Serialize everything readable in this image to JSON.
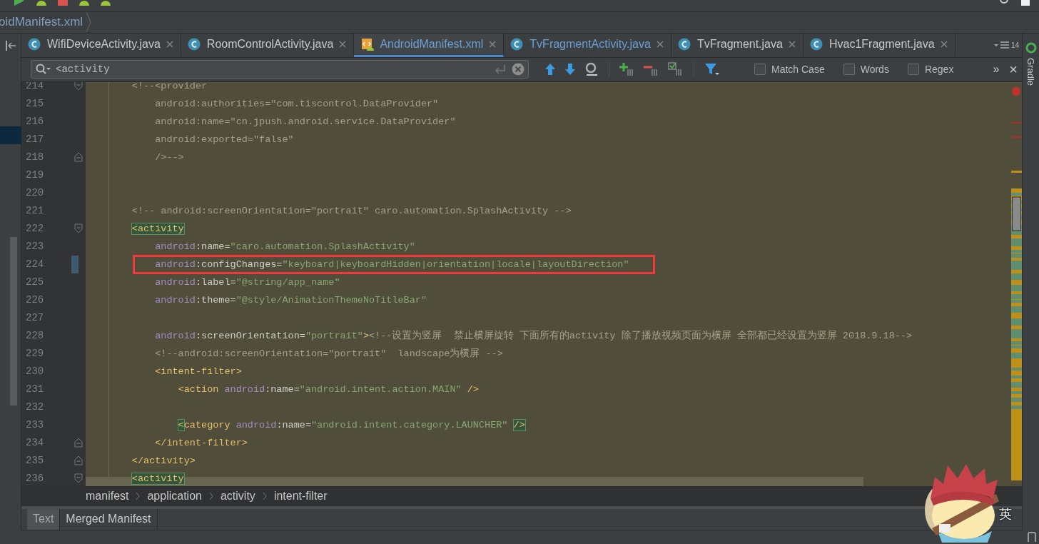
{
  "file_crumb": {
    "label": "oidManifest.xml"
  },
  "tabs": [
    {
      "label": "WifiDeviceActivity.java",
      "kind": "class",
      "selected": false,
      "modified": false
    },
    {
      "label": "RoomControlActivity.java",
      "kind": "class",
      "selected": false,
      "modified": false
    },
    {
      "label": "AndroidManifest.xml",
      "kind": "xml",
      "selected": true,
      "modified": true
    },
    {
      "label": "TvFragmentActivity.java",
      "kind": "class",
      "selected": false,
      "modified": true
    },
    {
      "label": "TvFragment.java",
      "kind": "class",
      "selected": false,
      "modified": false
    },
    {
      "label": "Hvac1Fragment.java",
      "kind": "class",
      "selected": false,
      "modified": false
    }
  ],
  "tab_overflow": {
    "count": "14"
  },
  "search": {
    "value": "<activity",
    "more": "»",
    "close": "×",
    "options": [
      {
        "label": "Match Case",
        "checked": false
      },
      {
        "label": "Words",
        "checked": false
      },
      {
        "label": "Regex",
        "checked": false
      }
    ]
  },
  "side_tool": {
    "label": "Gradle"
  },
  "editor": {
    "lines": [
      {
        "number": "214",
        "kind": "fold-start",
        "framed": false,
        "changed": false,
        "tokens": [
          {
            "kind": "comment",
            "text": "        <!--<provider"
          }
        ]
      },
      {
        "number": "215",
        "kind": "plain",
        "framed": false,
        "changed": false,
        "tokens": [
          {
            "kind": "comment",
            "text": "            android:authorities=\"com.tiscontrol.DataProvider\""
          }
        ]
      },
      {
        "number": "216",
        "kind": "plain",
        "framed": false,
        "changed": false,
        "tokens": [
          {
            "kind": "comment",
            "text": "            android:name=\"cn.jpush.android.service.DataProvider\""
          }
        ]
      },
      {
        "number": "217",
        "kind": "plain",
        "framed": false,
        "changed": false,
        "tokens": [
          {
            "kind": "comment",
            "text": "            android:exported=\"false\""
          }
        ]
      },
      {
        "number": "218",
        "kind": "fold-end",
        "framed": false,
        "changed": false,
        "tokens": [
          {
            "kind": "comment",
            "text": "            />-->"
          }
        ]
      },
      {
        "number": "219",
        "kind": "plain",
        "framed": false,
        "changed": false
      },
      {
        "number": "220",
        "kind": "plain",
        "framed": false,
        "changed": false
      },
      {
        "number": "221",
        "kind": "plain",
        "framed": false,
        "changed": false,
        "tokens": [
          {
            "kind": "comment",
            "text": "        <!-- android:screenOrientation=\"portrait\" caro.automation.SplashActivity -->"
          }
        ]
      },
      {
        "number": "222",
        "kind": "fold-start",
        "framed": false,
        "changed": false,
        "tokens": [
          {
            "kind": "match",
            "text": "        <activity"
          }
        ]
      },
      {
        "number": "223",
        "kind": "plain",
        "framed": false,
        "changed": false,
        "tokens": [
          {
            "kind": "ns",
            "text": "            android"
          },
          {
            "kind": "attr",
            "text": ":name="
          },
          {
            "kind": "value",
            "text": "\"caro.automation.SplashActivity\""
          }
        ]
      },
      {
        "number": "224",
        "kind": "plain",
        "framed": true,
        "changed": true,
        "tokens": [
          {
            "kind": "ns",
            "text": "            android"
          },
          {
            "kind": "attr",
            "text": ":configChanges="
          },
          {
            "kind": "value",
            "text": "\"keyboard|keyboardHidden|orientation|locale|layoutDirection\""
          }
        ]
      },
      {
        "number": "225",
        "kind": "plain",
        "framed": false,
        "changed": false,
        "tokens": [
          {
            "kind": "ns",
            "text": "            android"
          },
          {
            "kind": "attr",
            "text": ":label="
          },
          {
            "kind": "value",
            "text": "\"@string/app_name\""
          }
        ]
      },
      {
        "number": "226",
        "kind": "plain",
        "framed": false,
        "changed": false,
        "tokens": [
          {
            "kind": "ns",
            "text": "            android"
          },
          {
            "kind": "attr",
            "text": ":theme="
          },
          {
            "kind": "value",
            "text": "\"@style/AnimationThemeNoTitleBar\""
          }
        ]
      },
      {
        "number": "227",
        "kind": "plain",
        "framed": false,
        "changed": false
      },
      {
        "number": "228",
        "kind": "plain",
        "framed": false,
        "changed": false,
        "tokens": [
          {
            "kind": "ns",
            "text": "            android"
          },
          {
            "kind": "attr",
            "text": ":screenOrientation="
          },
          {
            "kind": "value",
            "text": "\"portrait\""
          },
          {
            "kind": "tag",
            "text": ">"
          },
          {
            "kind": "comment",
            "text": "<!--设置为竖屏  禁止横屏旋转 下面所有的activity 除了播放视频页面为横屏 全部都已经设置为竖屏 2018.9.18-->"
          }
        ]
      },
      {
        "number": "229",
        "kind": "plain",
        "framed": false,
        "changed": false,
        "tokens": [
          {
            "kind": "comment",
            "text": "            <!--android:screenOrientation=\"portrait\"  landscape为横屏 -->"
          }
        ]
      },
      {
        "number": "230",
        "kind": "plain",
        "framed": false,
        "changed": false,
        "tokens": [
          {
            "kind": "tag",
            "text": "            <intent-filter>"
          }
        ]
      },
      {
        "number": "231",
        "kind": "plain",
        "framed": false,
        "changed": false,
        "tokens": [
          {
            "kind": "tag",
            "text": "                <action "
          },
          {
            "kind": "ns",
            "text": "android"
          },
          {
            "kind": "attr",
            "text": ":name="
          },
          {
            "kind": "value",
            "text": "\"android.intent.action.MAIN\""
          },
          {
            "kind": "tag",
            "text": " />"
          }
        ]
      },
      {
        "number": "232",
        "kind": "plain",
        "framed": false,
        "changed": false
      },
      {
        "number": "233",
        "kind": "plain",
        "framed": false,
        "changed": false,
        "tokens": [
          {
            "kind": "match",
            "text": "                <"
          },
          {
            "kind": "tag",
            "text": "category "
          },
          {
            "kind": "ns",
            "text": "android"
          },
          {
            "kind": "attr",
            "text": ":name="
          },
          {
            "kind": "value",
            "text": "\"android.intent.category.LAUNCHER\" "
          },
          {
            "kind": "match",
            "text": "/>"
          }
        ]
      },
      {
        "number": "234",
        "kind": "fold-end",
        "framed": false,
        "changed": false,
        "tokens": [
          {
            "kind": "tag",
            "text": "            </intent-filter>"
          }
        ]
      },
      {
        "number": "235",
        "kind": "fold-end",
        "framed": false,
        "changed": false,
        "tokens": [
          {
            "kind": "tag",
            "text": "        </activity>"
          }
        ]
      },
      {
        "number": "236",
        "kind": "fold-start",
        "framed": false,
        "changed": false,
        "tokens": [
          {
            "kind": "match",
            "text": "        <activity"
          }
        ]
      }
    ]
  },
  "breadcrumbs": [
    "manifest",
    "application",
    "activity",
    "intent-filter"
  ],
  "bottom_tabs": [
    {
      "label": "Text",
      "selected": true
    },
    {
      "label": "Merged Manifest",
      "selected": false
    }
  ],
  "ime": {
    "label": "英"
  }
}
